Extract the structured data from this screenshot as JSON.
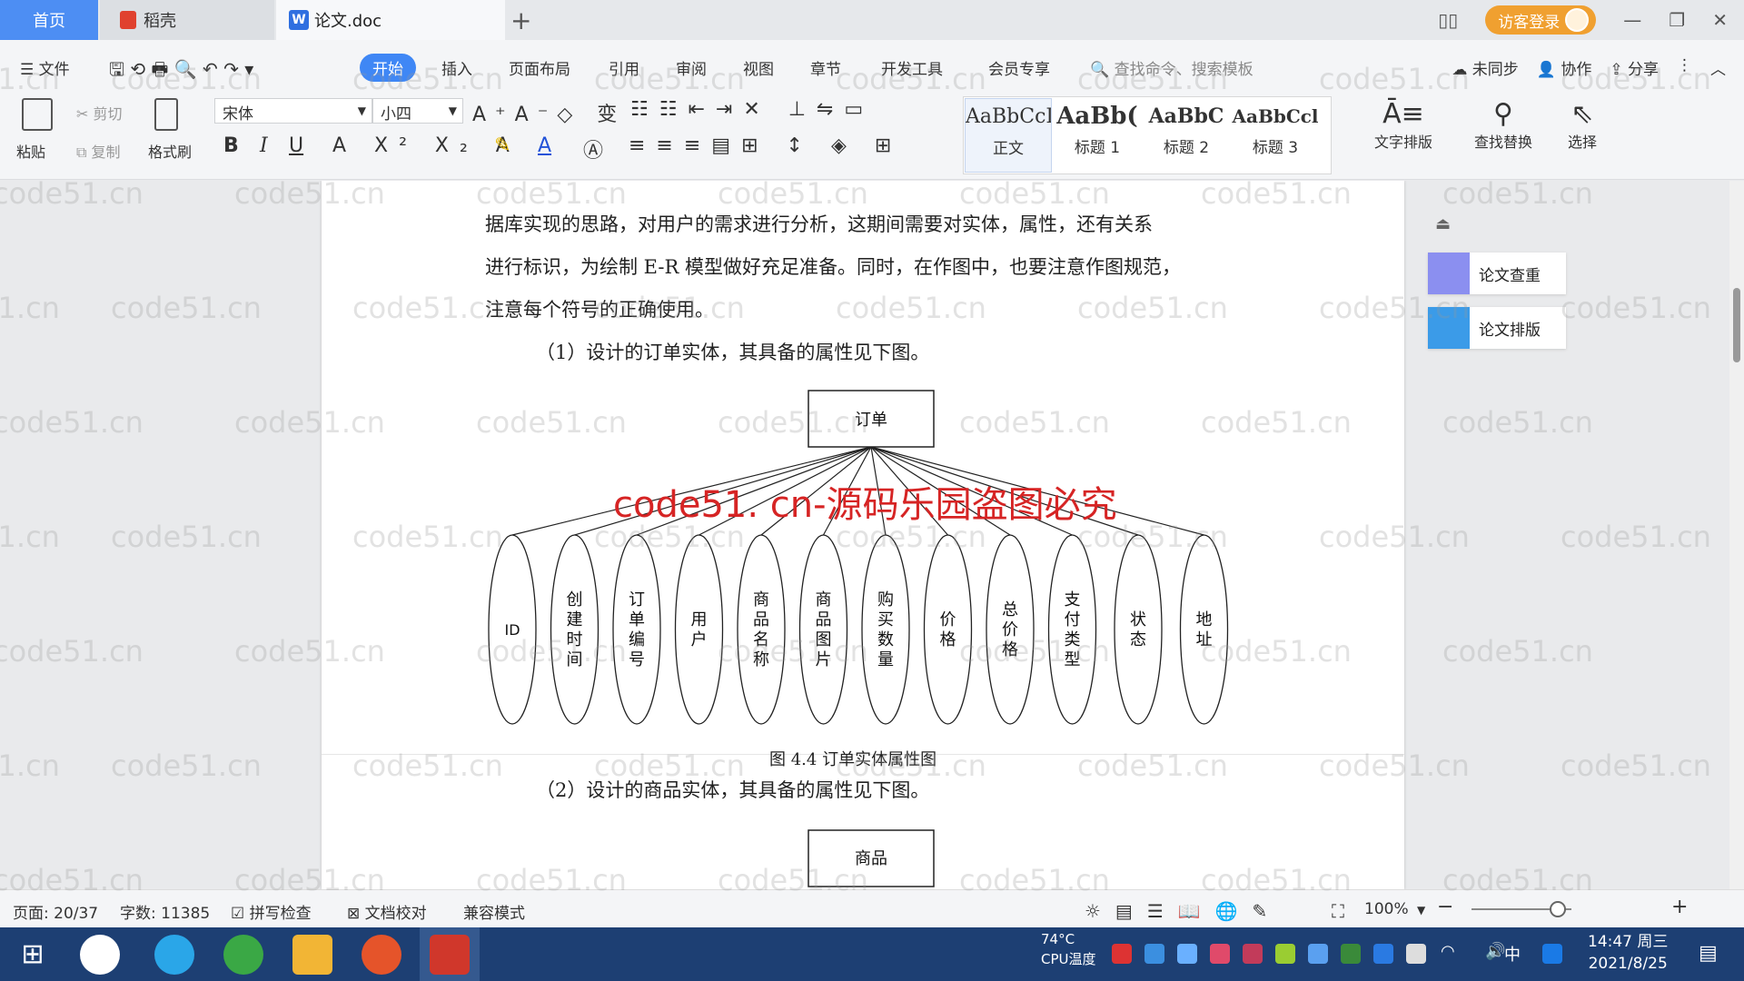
{
  "tabs": {
    "home": "首页",
    "docer": "稻壳",
    "doc": "论文.doc",
    "doc_icon": "W"
  },
  "window": {
    "login": "访客登录"
  },
  "menu": {
    "file": "文件",
    "items": [
      "开始",
      "插入",
      "页面布局",
      "引用",
      "审阅",
      "视图",
      "章节",
      "开发工具",
      "会员专享"
    ],
    "search": "查找命令、搜索模板",
    "sync": "未同步",
    "collab": "协作",
    "share": "分享"
  },
  "ribbon": {
    "paste": "粘贴",
    "cut": "剪切",
    "copy": "复制",
    "format_painter": "格式刷",
    "font": "宋体",
    "size": "小四",
    "styles": [
      {
        "sample": "AaBbCcI",
        "name": "正文"
      },
      {
        "sample": "AaBb(",
        "name": "标题 1"
      },
      {
        "sample": "AaBbC",
        "name": "标题 2"
      },
      {
        "sample": "AaBbCcl",
        "name": "标题 3"
      }
    ],
    "text_layout": "文字排版",
    "find_replace": "查找替换",
    "select": "选择"
  },
  "document": {
    "para1_line1": "据库实现的思路，对用户的需求进行分析，这期间需要对实体，属性，还有关系",
    "para1_line2": "进行标识，为绘制 E-R 模型做好充足准备。同时，在作图中，也要注意作图规范，",
    "para1_line3": "注意每个符号的正确使用。",
    "para2": "（1）设计的订单实体，其具备的属性见下图。",
    "entity": "订单",
    "attributes": [
      "ID",
      "创\n建\n时\n间",
      "订\n单\n编\n号",
      "用\n户",
      "商\n品\n名\n称",
      "商\n品\n图\n片",
      "购\n买\n数\n量",
      "价\n格",
      "总\n价\n格",
      "支\n付\n类\n型",
      "状\n态",
      "地\n址"
    ],
    "caption": "图 4.4  订单实体属性图",
    "para3": "（2）设计的商品实体，其具备的属性见下图。",
    "entity2": "商品"
  },
  "watermark": {
    "text": "code51.cn",
    "red": "code51. cn-源码乐园盗图必究"
  },
  "side_panel": {
    "check": "论文查重",
    "layout": "论文排版"
  },
  "status": {
    "page": "页面: 20/37",
    "words": "字数: 11385",
    "spell": "拼写检查",
    "proof": "文档校对",
    "compat": "兼容模式",
    "zoom": "100%"
  },
  "taskbar": {
    "cpu_temp": "74°C",
    "cpu_label": "CPU温度",
    "ime": "中",
    "time": "14:47 周三",
    "date": "2021/8/25"
  },
  "colors": {
    "accent": "#3f87f5",
    "taskbar": "#1d3f73",
    "watermark_red": "#d62424"
  }
}
